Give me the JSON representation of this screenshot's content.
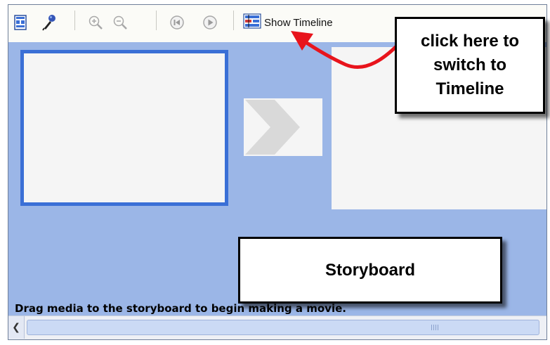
{
  "toolbar": {
    "show_timeline_label": "Show Timeline",
    "icons": [
      "storyboard-icon",
      "narrate-icon",
      "zoom-in-icon",
      "zoom-out-icon",
      "rewind-icon",
      "play-icon",
      "timeline-icon"
    ]
  },
  "storyboard": {
    "hint": "Drag media to the storyboard to begin making a movie."
  },
  "annotations": {
    "timeline_callout": [
      "click here to",
      "switch to",
      "Timeline"
    ],
    "storyboard_label": "Storyboard"
  },
  "colors": {
    "storyboard_bg": "#9bb6e7",
    "selected_border": "#3a6fd6",
    "arrow": "#e8141c"
  }
}
